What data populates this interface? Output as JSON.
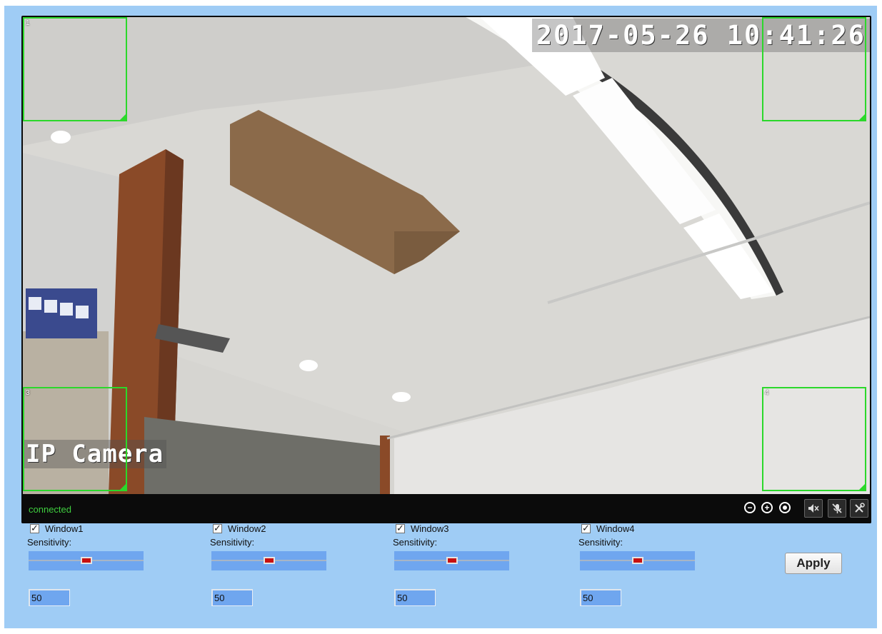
{
  "video": {
    "timestamp": "2017-05-26 10:41:26",
    "camera_name": "IP Camera",
    "status": "connected",
    "zones": [
      {
        "label": "1"
      },
      {
        "label": ""
      },
      {
        "label": "3"
      },
      {
        "label": "4"
      }
    ],
    "controls": [
      {
        "icon": "zoom-out-icon"
      },
      {
        "icon": "zoom-in-icon"
      },
      {
        "icon": "record-icon"
      },
      {
        "icon": "mute-icon"
      },
      {
        "icon": "mic-off-icon"
      },
      {
        "icon": "settings-tools-icon"
      }
    ]
  },
  "windows": [
    {
      "label": "Window1",
      "checked": true,
      "sensitivity_label": "Sensitivity:",
      "value": "50",
      "level": 0.5
    },
    {
      "label": "Window2",
      "checked": true,
      "sensitivity_label": "Sensitivity:",
      "value": "50",
      "level": 0.5
    },
    {
      "label": "Window3",
      "checked": true,
      "sensitivity_label": "Sensitivity:",
      "value": "50",
      "level": 0.5
    },
    {
      "label": "Window4",
      "checked": true,
      "sensitivity_label": "Sensitivity:",
      "value": "50",
      "level": 0.5
    }
  ],
  "apply_label": "Apply",
  "colors": {
    "panel_bg": "#9fccf5",
    "zone_border": "#2bd82b",
    "status_text": "#3fcf3f",
    "slider_bg": "#6fa6ef",
    "slider_thumb": "#c81010"
  }
}
